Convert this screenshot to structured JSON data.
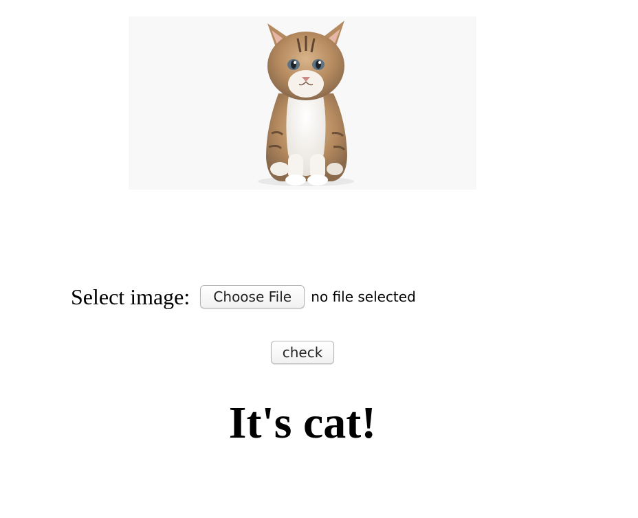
{
  "form": {
    "label": "Select image:",
    "choose_button": "Choose File",
    "file_status": "no file selected",
    "check_button": "check"
  },
  "result": {
    "text": "It's cat!"
  },
  "preview": {
    "subject": "kitten-photo"
  }
}
